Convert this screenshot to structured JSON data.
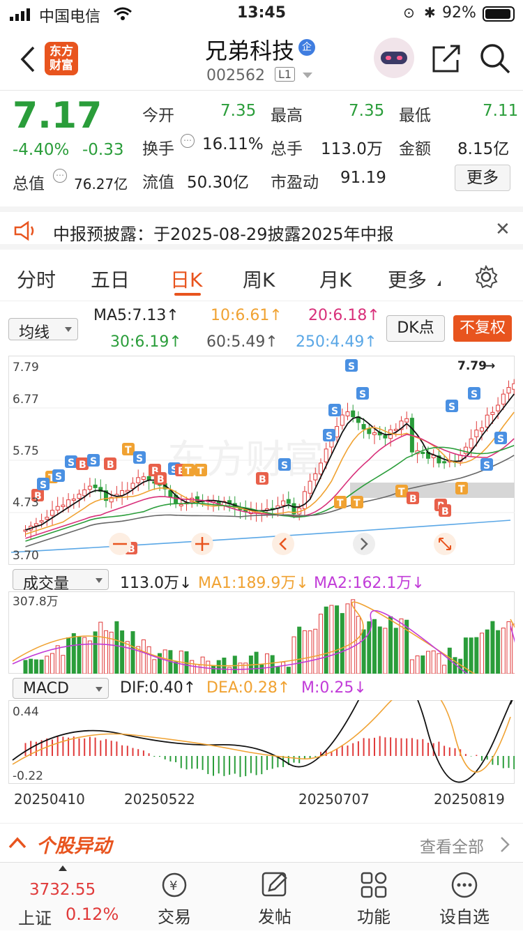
{
  "status_bar": {
    "carrier": "中国电信",
    "time": "13:45",
    "battery": "92%"
  },
  "header": {
    "logo_line1": "东方",
    "logo_line2": "财富",
    "stock_name": "兄弟科技",
    "enterprise_badge": "企",
    "stock_code": "002562",
    "level": "L1"
  },
  "quote": {
    "price": "7.17",
    "change_pct": "-4.40%",
    "change_amt": "-0.33",
    "total_value_label": "总值",
    "total_value": "76.27亿",
    "rows": [
      [
        {
          "label": "今开",
          "value": "7.35",
          "color": "#2a9d3a"
        },
        {
          "label": "最高",
          "value": "7.35",
          "color": "#2a9d3a"
        },
        {
          "label": "最低",
          "value": "7.11",
          "color": "#2a9d3a"
        }
      ],
      [
        {
          "label": "换手",
          "value": "16.11%",
          "color": "#222"
        },
        {
          "label": "总手",
          "value": "113.0万",
          "color": "#222"
        },
        {
          "label": "金额",
          "value": "8.15亿",
          "color": "#222"
        }
      ],
      [
        {
          "label": "流值",
          "value": "50.30亿",
          "color": "#222"
        },
        {
          "label": "市盈动",
          "value": "91.19",
          "color": "#222"
        }
      ]
    ],
    "more_button": "更多"
  },
  "notice": {
    "text": "中报预披露：于2025-08-29披露2025年中报"
  },
  "tabs": [
    "分时",
    "五日",
    "日K",
    "周K",
    "月K",
    "更多"
  ],
  "active_tab": "日K",
  "main_chart": {
    "indicator_select": "均线",
    "ma_legends": [
      {
        "text": "MA5:7.13↑",
        "color": "#222"
      },
      {
        "text": "10:6.61↑",
        "color": "#f0a232"
      },
      {
        "text": "20:6.18↑",
        "color": "#d8307a"
      },
      {
        "text": "30:6.19↑",
        "color": "#2a9d3a"
      },
      {
        "text": "60:5.49↑",
        "color": "#555"
      },
      {
        "text": "250:4.49↑",
        "color": "#5aa7e6"
      }
    ],
    "dk_button": "DK点",
    "fq_button": "不复权",
    "y_ticks": [
      "7.79",
      "6.77",
      "5.75",
      "4.73",
      "3.70"
    ],
    "max_label": "7.79"
  },
  "volume_chart": {
    "select": "成交量",
    "value": "113.0万↓",
    "ma1": "MA1:189.9万↓",
    "ma2": "MA2:162.1万↓",
    "max_tick": "307.8万"
  },
  "macd_chart": {
    "select": "MACD",
    "dif": "DIF:0.40↑",
    "dea": "DEA:0.28↑",
    "m": "M:0.25↓",
    "y_top": "0.44",
    "y_bottom": "-0.22"
  },
  "dates": [
    "20250410",
    "20250522",
    "20250707",
    "20250819"
  ],
  "alert": {
    "title": "个股异动",
    "view_all": "查看全部"
  },
  "bottom_nav": {
    "index_value": "3732.55",
    "index_name": "上证",
    "index_change": "0.12%",
    "items": [
      "交易",
      "发帖",
      "功能",
      "设自选"
    ]
  },
  "colors": {
    "up": "#e03a3a",
    "down": "#2a9d3a",
    "brand": "#e8541e"
  }
}
